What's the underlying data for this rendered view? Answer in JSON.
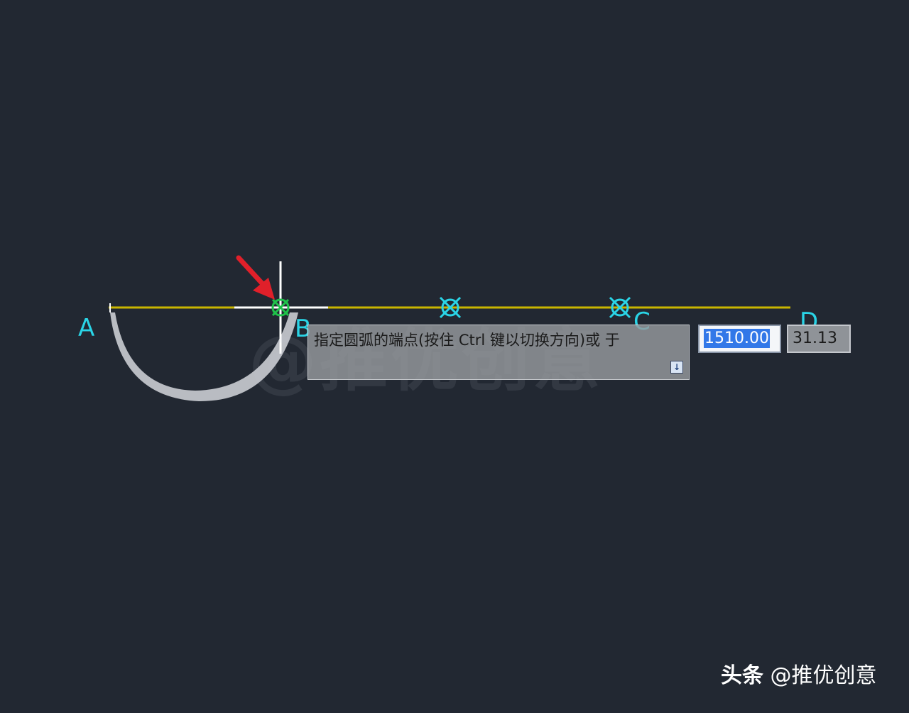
{
  "drawing": {
    "point_labels": {
      "a": "A",
      "b": "B",
      "c": "C",
      "d": "D"
    },
    "colors": {
      "background": "#222832",
      "baseline": "#c9b600",
      "point_label": "#2ad4e6",
      "snap_marker": "#2ad4e6",
      "active_snap": "#1fc24a",
      "arc_fill": "#b9bcc2",
      "crosshair": "#ffffff",
      "arrow": "#e0202a"
    },
    "icons": [
      "snap-marker-icon",
      "active-snap-marker-icon",
      "red-arrow-icon",
      "crosshair-cursor"
    ]
  },
  "watermark": {
    "text": "@推优创意"
  },
  "tooltip": {
    "prompt": "指定圆弧的端点(按住 Ctrl 键以切换方向)或 于",
    "icon": "down-arrow-icon"
  },
  "dynamic_input": {
    "length_value": "1510.00",
    "angle_value": "31.13"
  },
  "brand": {
    "platform": "头条",
    "handle": "@推优创意"
  }
}
